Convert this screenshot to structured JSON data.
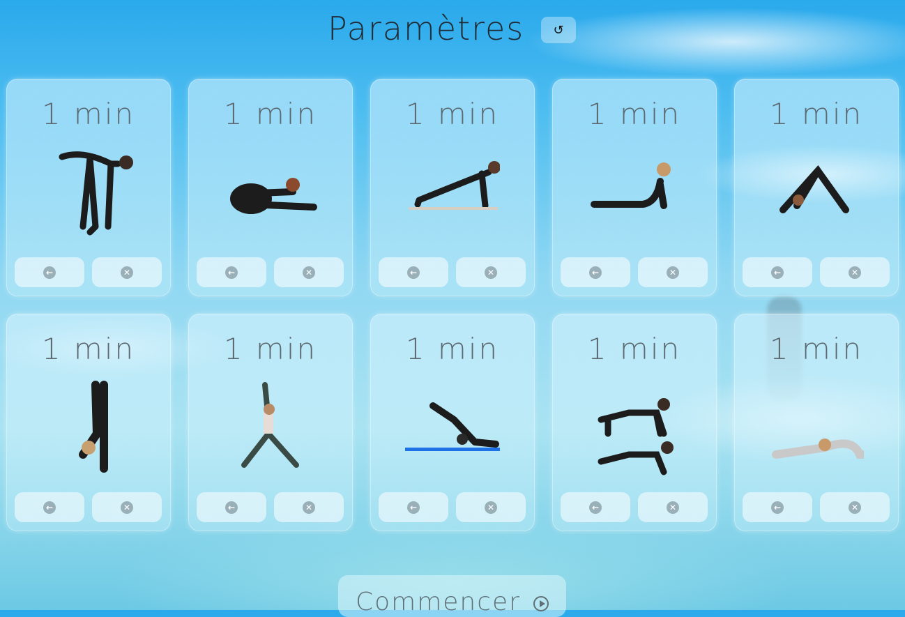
{
  "header": {
    "title": "Paramètres",
    "reset_icon": "reset-icon"
  },
  "cards": [
    {
      "duration": "1 min",
      "pose": "standing forward fold"
    },
    {
      "duration": "1 min",
      "pose": "seated forward fold"
    },
    {
      "duration": "1 min",
      "pose": "plank"
    },
    {
      "duration": "1 min",
      "pose": "cobra"
    },
    {
      "duration": "1 min",
      "pose": "downward dog"
    },
    {
      "duration": "1 min",
      "pose": "standing fold hands to floor"
    },
    {
      "duration": "1 min",
      "pose": "warrior one"
    },
    {
      "duration": "1 min",
      "pose": "plow"
    },
    {
      "duration": "1 min",
      "pose": "cat cow"
    },
    {
      "duration": "1 min",
      "pose": "child pose"
    }
  ],
  "card_buttons": {
    "back_icon": "arrow-left-icon",
    "remove_icon": "close-circle-icon"
  },
  "start": {
    "label": "Commencer",
    "icon": "play-icon"
  },
  "colors": {
    "sky_top": "#2aa9ec",
    "sky_bottom": "#a9e3f2",
    "card_text": "#5b6870",
    "icon_gray": "#9ab0b8"
  }
}
